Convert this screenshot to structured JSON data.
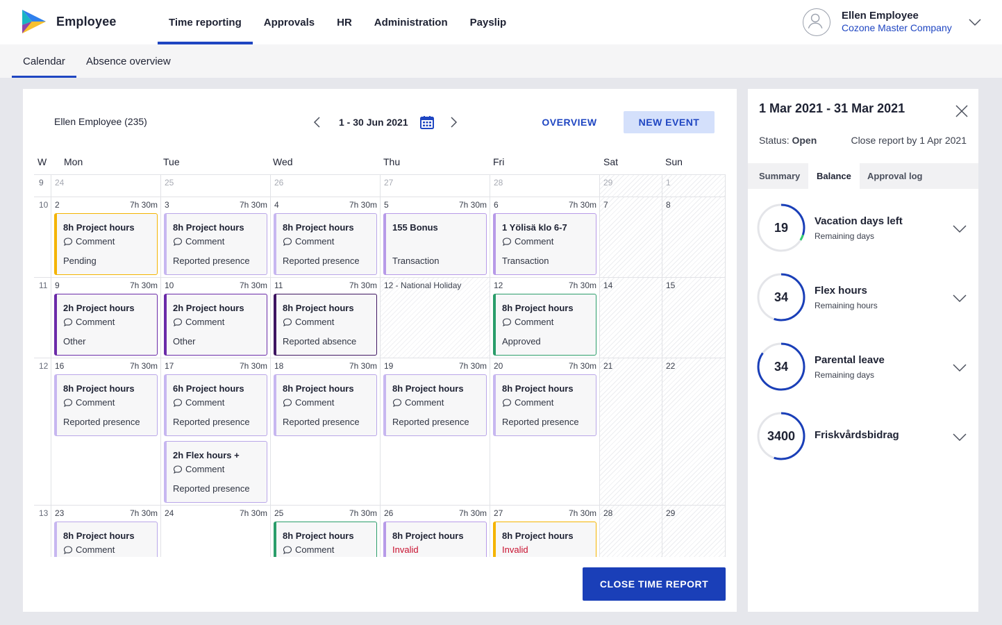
{
  "header": {
    "app_name": "Employee",
    "nav": [
      "Time reporting",
      "Approvals",
      "HR",
      "Administration",
      "Payslip"
    ],
    "active_nav": "Time reporting",
    "user_name": "Ellen Employee",
    "company": "Cozone Master Company",
    "brand_color": "#1f46c2"
  },
  "subnav": {
    "tabs": [
      "Calendar",
      "Absence overview"
    ],
    "active": "Calendar"
  },
  "calendar": {
    "employee": "Ellen Employee (235)",
    "range": "1 - 30 Jun 2021",
    "overview_label": "OVERVIEW",
    "new_event_label": "NEW EVENT",
    "week_col": "W",
    "days": [
      "Mon",
      "Tue",
      "Wed",
      "Thu",
      "Fri",
      "Sat",
      "Sun"
    ],
    "comment_label": "Comment",
    "weeks": [
      {
        "week": "9",
        "dates": [
          "24",
          "25",
          "26",
          "27",
          "28",
          "29",
          "1"
        ]
      },
      {
        "week": "10",
        "dates": [
          "2",
          "3",
          "4",
          "5",
          "6",
          "7",
          "8"
        ],
        "hours": [
          "7h 30m",
          "7h 30m",
          "7h 30m",
          "7h 30m",
          "7h 30m",
          "",
          ""
        ],
        "events": [
          {
            "day": 0,
            "title": "8h Project hours",
            "comment": true,
            "status": "Pending",
            "kind": "pending"
          },
          {
            "day": 1,
            "title": "8h Project hours",
            "comment": true,
            "status": "Reported presence",
            "kind": "presence"
          },
          {
            "day": 2,
            "title": "8h Project hours",
            "comment": true,
            "status": "Reported presence",
            "kind": "presence"
          },
          {
            "day": 3,
            "title": "155 Bonus",
            "comment": false,
            "status": "Transaction",
            "kind": "transaction"
          },
          {
            "day": 4,
            "title": "1 Yölisä klo 6-7",
            "comment": true,
            "status": "Transaction",
            "kind": "transaction"
          }
        ]
      },
      {
        "week": "11",
        "dates": [
          "9",
          "10",
          "11",
          "12 - National Holiday",
          "12",
          "14",
          "15"
        ],
        "hours": [
          "7h 30m",
          "7h 30m",
          "7h 30m",
          "",
          "7h 30m",
          "",
          ""
        ],
        "events": [
          {
            "day": 0,
            "title": "2h Project hours",
            "comment": true,
            "status": "Other",
            "kind": "other"
          },
          {
            "day": 1,
            "title": "2h Project hours",
            "comment": true,
            "status": "Other",
            "kind": "other"
          },
          {
            "day": 2,
            "title": "8h Project hours",
            "comment": true,
            "status": "Reported absence",
            "kind": "absence"
          },
          {
            "day": 4,
            "title": "8h Project hours",
            "comment": true,
            "status": "Approved",
            "kind": "approved"
          }
        ]
      },
      {
        "week": "12",
        "dates": [
          "16",
          "17",
          "18",
          "19",
          "20",
          "21",
          "22"
        ],
        "hours": [
          "7h 30m",
          "7h 30m",
          "7h 30m",
          "7h 30m",
          "7h 30m",
          "",
          ""
        ],
        "events": [
          {
            "day": 0,
            "title": "8h Project hours",
            "comment": true,
            "status": "Reported presence",
            "kind": "presence"
          },
          {
            "day": 1,
            "title": "6h Project hours",
            "comment": true,
            "status": "Reported presence",
            "kind": "presence"
          },
          {
            "day": 1,
            "title": "2h Flex hours +",
            "comment": true,
            "status": "Reported presence",
            "kind": "presence",
            "slot": 1
          },
          {
            "day": 2,
            "title": "8h Project hours",
            "comment": true,
            "status": "Reported presence",
            "kind": "presence"
          },
          {
            "day": 3,
            "title": "8h Project hours",
            "comment": true,
            "status": "Reported presence",
            "kind": "presence"
          },
          {
            "day": 4,
            "title": "8h Project hours",
            "comment": true,
            "status": "Reported presence",
            "kind": "presence"
          }
        ]
      },
      {
        "week": "13",
        "dates": [
          "23",
          "24",
          "25",
          "26",
          "27",
          "28",
          "29"
        ],
        "hours": [
          "7h 30m",
          "7h 30m",
          "7h 30m",
          "7h 30m",
          "7h 30m",
          "",
          ""
        ],
        "events": [
          {
            "day": 0,
            "title": "8h Project hours",
            "comment": true,
            "status": "",
            "kind": "presence"
          },
          {
            "day": 2,
            "title": "8h Project hours",
            "comment": true,
            "status": "",
            "kind": "approved"
          },
          {
            "day": 3,
            "title": "8h Project hours",
            "comment": false,
            "status": "Invalid",
            "kind": "transaction"
          },
          {
            "day": 4,
            "title": "8h Project hours",
            "comment": false,
            "status": "Invalid",
            "kind": "invalid"
          }
        ]
      }
    ],
    "close_label": "CLOSE TIME REPORT"
  },
  "side": {
    "period": "1 Mar 2021 - 31 Mar 2021",
    "status_label": "Status:",
    "status_value": "Open",
    "close_by": "Close report by 1 Apr 2021",
    "tabs": [
      "Summary",
      "Balance",
      "Approval log"
    ],
    "active_tab": "Balance",
    "balances": [
      {
        "value": "19",
        "name": "Vacation days left",
        "sub": "Remaining days",
        "fraction": 0.3,
        "color": "#1a3fb8",
        "accent": "#2ecc71"
      },
      {
        "value": "34",
        "name": "Flex hours",
        "sub": "Remaining hours",
        "fraction": 0.55,
        "color": "#1a3fb8"
      },
      {
        "value": "34",
        "name": "Parental leave",
        "sub": "Remaining days",
        "fraction": 0.85,
        "color": "#1a3fb8"
      },
      {
        "value": "3400",
        "name": "Friskvårdsbidrag",
        "sub": "",
        "fraction": 0.55,
        "color": "#1a3fb8"
      }
    ]
  }
}
